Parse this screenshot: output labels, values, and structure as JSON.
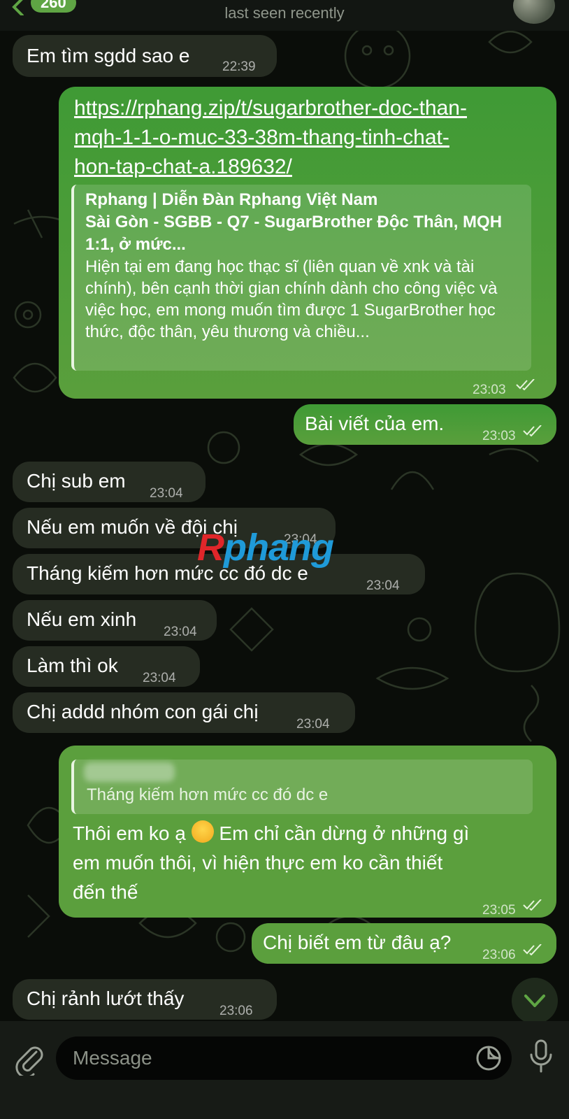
{
  "header": {
    "unread_count": "260",
    "status": "last seen recently"
  },
  "watermark": {
    "r": "R",
    "rest": "phang"
  },
  "messages": [
    {
      "text": "Em tìm sgdd sao e",
      "time": "22:39"
    },
    {
      "link": "https://rphang.zip/t/sugarbrother-doc-than-mqh-1-1-o-muc-33-38m-thang-tinh-chat-hon-tap-chat-a.189632/",
      "link_lines": [
        "https://rphang.zip/t/sugarbrother-doc-than-",
        "mqh-1-1-o-muc-33-38m-thang-tinh-chat-",
        "hon-tap-chat-a.189632/"
      ],
      "preview_site": "Rphang | Diễn Đàn Rphang Việt Nam",
      "preview_title": "Sài Gòn - SGBB - Q7 - SugarBrother Độc Thân, MQH 1:1, ở mức...",
      "preview_desc": "Hiện tại em đang học thạc sĩ (liên quan về xnk và tài chính), bên cạnh thời gian chính dành cho công việc và việc học, em mong muốn tìm được 1 SugarBrother học thức, độc thân, yêu thương và chiều...",
      "time": "23:03"
    },
    {
      "text": "Bài viết của em.",
      "time": "23:03"
    },
    {
      "text": "Chị sub em",
      "time": "23:04"
    },
    {
      "text": "Nếu em muốn về đội chị",
      "time": "23:04"
    },
    {
      "text": "Tháng kiếm hơn mức cc đó dc e",
      "time": "23:04"
    },
    {
      "text": "Nếu em xinh",
      "time": "23:04"
    },
    {
      "text": "Làm thì ok",
      "time": "23:04"
    },
    {
      "text": "Chị addd nhóm con gái chị",
      "time": "23:04"
    },
    {
      "reply_text": "Tháng kiếm hơn mức cc đó dc e",
      "line1": "Thôi em ko ạ",
      "line1b": "Em chỉ cần dừng ở những gì",
      "line2": "em muốn thôi, vì hiện thực em ko cần thiết",
      "line3": "đến thế",
      "time": "23:05"
    },
    {
      "text": "Chị biết em từ đâu ạ?",
      "time": "23:06"
    },
    {
      "text": "Chị rảnh lướt thấy",
      "time": "23:06"
    }
  ],
  "input": {
    "placeholder": "Message"
  },
  "colors": {
    "incoming": "#262c22",
    "outgoing": "#4a9c38",
    "accent": "#5fa544"
  },
  "icons": [
    "back-arrow-icon",
    "double-check-icon",
    "chevron-down-icon",
    "paperclip-icon",
    "sticker-icon",
    "microphone-icon",
    "emoji-sweat-smile-icon"
  ]
}
